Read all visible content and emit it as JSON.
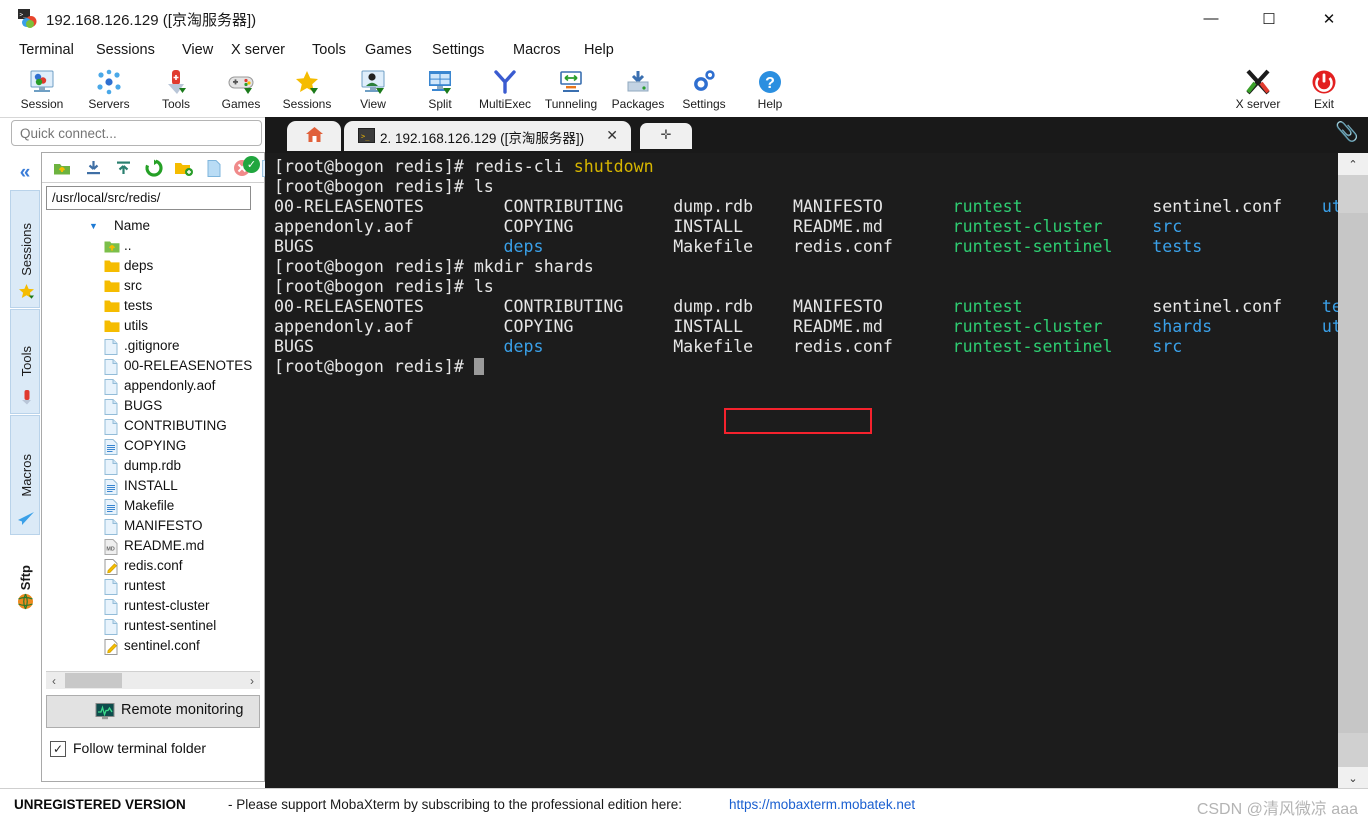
{
  "window": {
    "title": "192.168.126.129 ([京淘服务器])",
    "app_icon": "mobaxterm-icon",
    "controls": {
      "minimize": "—",
      "maximize": "☐",
      "close": "✕"
    }
  },
  "menubar": [
    {
      "label": "Terminal"
    },
    {
      "label": "Sessions"
    },
    {
      "label": "View"
    },
    {
      "label": "X server"
    },
    {
      "label": "Tools"
    },
    {
      "label": "Games"
    },
    {
      "label": "Settings"
    },
    {
      "label": "Macros"
    },
    {
      "label": "Help"
    }
  ],
  "toolbar": {
    "left_buttons": [
      {
        "label": "Session",
        "icon": "session-icon"
      },
      {
        "label": "Servers",
        "icon": "servers-icon"
      },
      {
        "label": "Tools",
        "icon": "tools-knife-icon"
      },
      {
        "label": "Games",
        "icon": "gamepad-icon"
      },
      {
        "label": "Sessions",
        "icon": "star-icon"
      },
      {
        "label": "View",
        "icon": "view-monitor-icon"
      },
      {
        "label": "Split",
        "icon": "split-grid-icon"
      },
      {
        "label": "MultiExec",
        "icon": "multiexec-fork-icon"
      },
      {
        "label": "Tunneling",
        "icon": "tunneling-icon"
      },
      {
        "label": "Packages",
        "icon": "packages-download-icon"
      },
      {
        "label": "Settings",
        "icon": "gear-icon"
      },
      {
        "label": "Help",
        "icon": "help-question-icon"
      }
    ],
    "right_buttons": [
      {
        "label": "X server",
        "icon": "x-server-icon"
      },
      {
        "label": "Exit",
        "icon": "power-exit-icon"
      }
    ]
  },
  "sidebar": {
    "collapse_icon": "double-chevron-left-icon",
    "vertical_tabs": [
      {
        "label": "Sessions",
        "icon": "star-icon"
      },
      {
        "label": "Tools",
        "icon": "tools-knife-icon"
      },
      {
        "label": "Macros",
        "icon": "paper-plane-icon"
      },
      {
        "label": "Sftp",
        "icon": "globe-icon"
      }
    ]
  },
  "quick_connect": {
    "placeholder": "Quick connect...",
    "value": ""
  },
  "sftp_panel": {
    "toolbar_icons": [
      "parent-folder-icon",
      "download-icon",
      "upload-icon",
      "refresh-icon",
      "new-folder-icon",
      "new-file-icon",
      "delete-icon",
      "text-mode-icon"
    ],
    "path": "/usr/local/src/redis/",
    "path_status_icon": "check-circle-icon",
    "column_header": "Name",
    "sort_icon": "sort-desc-icon",
    "files": [
      {
        "name": "..",
        "icon": "parent-folder-icon"
      },
      {
        "name": "deps",
        "icon": "folder-icon"
      },
      {
        "name": "src",
        "icon": "folder-icon"
      },
      {
        "name": "tests",
        "icon": "folder-icon"
      },
      {
        "name": "utils",
        "icon": "folder-icon"
      },
      {
        "name": ".gitignore",
        "icon": "file-blank-icon"
      },
      {
        "name": "00-RELEASENOTES",
        "icon": "file-blank-icon"
      },
      {
        "name": "appendonly.aof",
        "icon": "file-blank-icon"
      },
      {
        "name": "BUGS",
        "icon": "file-blank-icon"
      },
      {
        "name": "CONTRIBUTING",
        "icon": "file-blank-icon"
      },
      {
        "name": "COPYING",
        "icon": "file-text-icon"
      },
      {
        "name": "dump.rdb",
        "icon": "file-blank-icon"
      },
      {
        "name": "INSTALL",
        "icon": "file-text-icon"
      },
      {
        "name": "Makefile",
        "icon": "file-text-icon"
      },
      {
        "name": "MANIFESTO",
        "icon": "file-blank-icon"
      },
      {
        "name": "README.md",
        "icon": "file-markdown-icon"
      },
      {
        "name": "redis.conf",
        "icon": "file-edit-icon"
      },
      {
        "name": "runtest",
        "icon": "file-blank-icon"
      },
      {
        "name": "runtest-cluster",
        "icon": "file-blank-icon"
      },
      {
        "name": "runtest-sentinel",
        "icon": "file-blank-icon"
      },
      {
        "name": "sentinel.conf",
        "icon": "file-edit-icon"
      }
    ],
    "hscroll": {
      "left_arrow": "‹",
      "right_arrow": "›"
    },
    "remote_monitoring": {
      "label": "Remote monitoring",
      "icon": "monitor-graph-icon"
    },
    "follow_terminal_folder": {
      "label": "Follow terminal folder",
      "checked": true,
      "check_glyph": "✓"
    }
  },
  "tabs": {
    "home": {
      "icon": "home-icon"
    },
    "active": {
      "label": "2.  192.168.126.129  ([京淘服务器])",
      "icon": "terminal-icon",
      "close_glyph": "✕"
    },
    "new_tab": {
      "glyph": "✛"
    },
    "clip_icon": "paperclip-icon"
  },
  "terminal": {
    "prompt": "[root@bogon redis]# ",
    "lines": [
      {
        "id": "l1",
        "prompt": "[root@bogon redis]# ",
        "cmd": "redis-cli ",
        "arg": "shutdown"
      },
      {
        "id": "l2",
        "prompt": "[root@bogon redis]# ",
        "cmd": "ls",
        "arg": ""
      },
      {
        "id": "l3",
        "cols": [
          "00-RELEASENOTES",
          "CONTRIBUTING",
          "dump.rdb",
          "MANIFESTO",
          "runtest",
          "sentinel.conf",
          "utils"
        ]
      },
      {
        "id": "l4",
        "cols": [
          "appendonly.aof",
          "COPYING",
          "INSTALL",
          "README.md",
          "runtest-cluster",
          "src",
          ""
        ]
      },
      {
        "id": "l5",
        "cols": [
          "BUGS",
          "deps",
          "Makefile",
          "redis.conf",
          "runtest-sentinel",
          "tests",
          ""
        ]
      },
      {
        "id": "l6",
        "prompt": "[root@bogon redis]# ",
        "cmd": "mkdir shards",
        "arg": ""
      },
      {
        "id": "l7",
        "prompt": "[root@bogon redis]# ",
        "cmd": "ls",
        "arg": ""
      },
      {
        "id": "l8",
        "cols": [
          "00-RELEASENOTES",
          "CONTRIBUTING",
          "dump.rdb",
          "MANIFESTO",
          "runtest",
          "sentinel.conf",
          "tests"
        ]
      },
      {
        "id": "l9",
        "cols": [
          "appendonly.aof",
          "COPYING",
          "INSTALL",
          "README.md",
          "runtest-cluster",
          "shards",
          "utils"
        ]
      },
      {
        "id": "l10",
        "cols": [
          "BUGS",
          "deps",
          "Makefile",
          "redis.conf",
          "runtest-sentinel",
          "src",
          ""
        ]
      },
      {
        "id": "l11",
        "prompt": "[root@bogon redis]# ",
        "cmd": "",
        "arg": ""
      }
    ],
    "highlight": {
      "text": "mkdir shards",
      "color": "#f5222d"
    },
    "colors": {
      "background": "#1c1c1c",
      "default_text": "#e6e6e6",
      "directory": "#3aa0e8",
      "executable": "#2ecc71",
      "keyword": "#d7b600"
    },
    "scrollbar": {
      "up_glyph": "⌃",
      "down_glyph": "⌄"
    }
  },
  "statusbar": {
    "unregistered": "UNREGISTERED VERSION",
    "message": "-  Please support MobaXterm by subscribing to the professional edition here:",
    "link": "https://mobaxterm.mobatek.net",
    "watermark": "CSDN @清风微凉 aaa"
  }
}
